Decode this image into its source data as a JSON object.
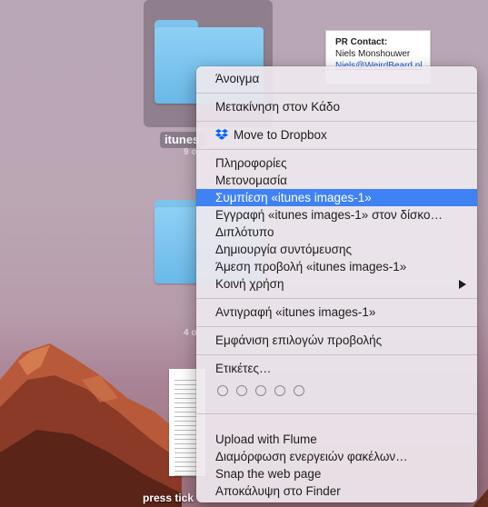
{
  "desktop": {
    "folder_label": "itunes",
    "folder_sub1": "9 σ",
    "folder_sub2": "4 σ",
    "doc_card": {
      "line1": "PR Contact:",
      "line2": "Niels Monshouwer",
      "line3": "Niels@WeirdBeard.nl"
    },
    "bottom_label": "press tick"
  },
  "context_menu": {
    "open": "Άνοιγμα",
    "move_to_trash": "Μετακίνηση στον Κάδο",
    "move_to_dropbox": "Move to Dropbox",
    "get_info": "Πληροφορίες",
    "rename": "Μετονομασία",
    "compress": "Συμπίεση «itunes images-1»",
    "burn": "Εγγραφή «itunes images-1» στον δίσκο…",
    "duplicate": "Διπλότυπο",
    "make_alias": "Δημιουργία συντόμευσης",
    "quick_look": "Άμεση προβολή «itunes images-1»",
    "share": "Κοινή χρήση",
    "copy": "Αντιγραφή «itunes images-1»",
    "show_view_options": "Εμφάνιση επιλογών προβολής",
    "tags": "Ετικέτες…",
    "upload_flume": "Upload with Flume",
    "folder_actions": "Διαμόρφωση ενεργειών φακέλων…",
    "snap_web": "Snap the web page",
    "reveal_finder": "Αποκάλυψη στο Finder"
  },
  "colors": {
    "selection": "#3f82f3",
    "folder_blue": "#7dc3ec",
    "dropbox_blue": "#0061fe"
  },
  "icons": {
    "dropbox": "dropbox-icon",
    "submenu": "submenu-arrow-icon",
    "tag": "tag-circle-icon"
  }
}
